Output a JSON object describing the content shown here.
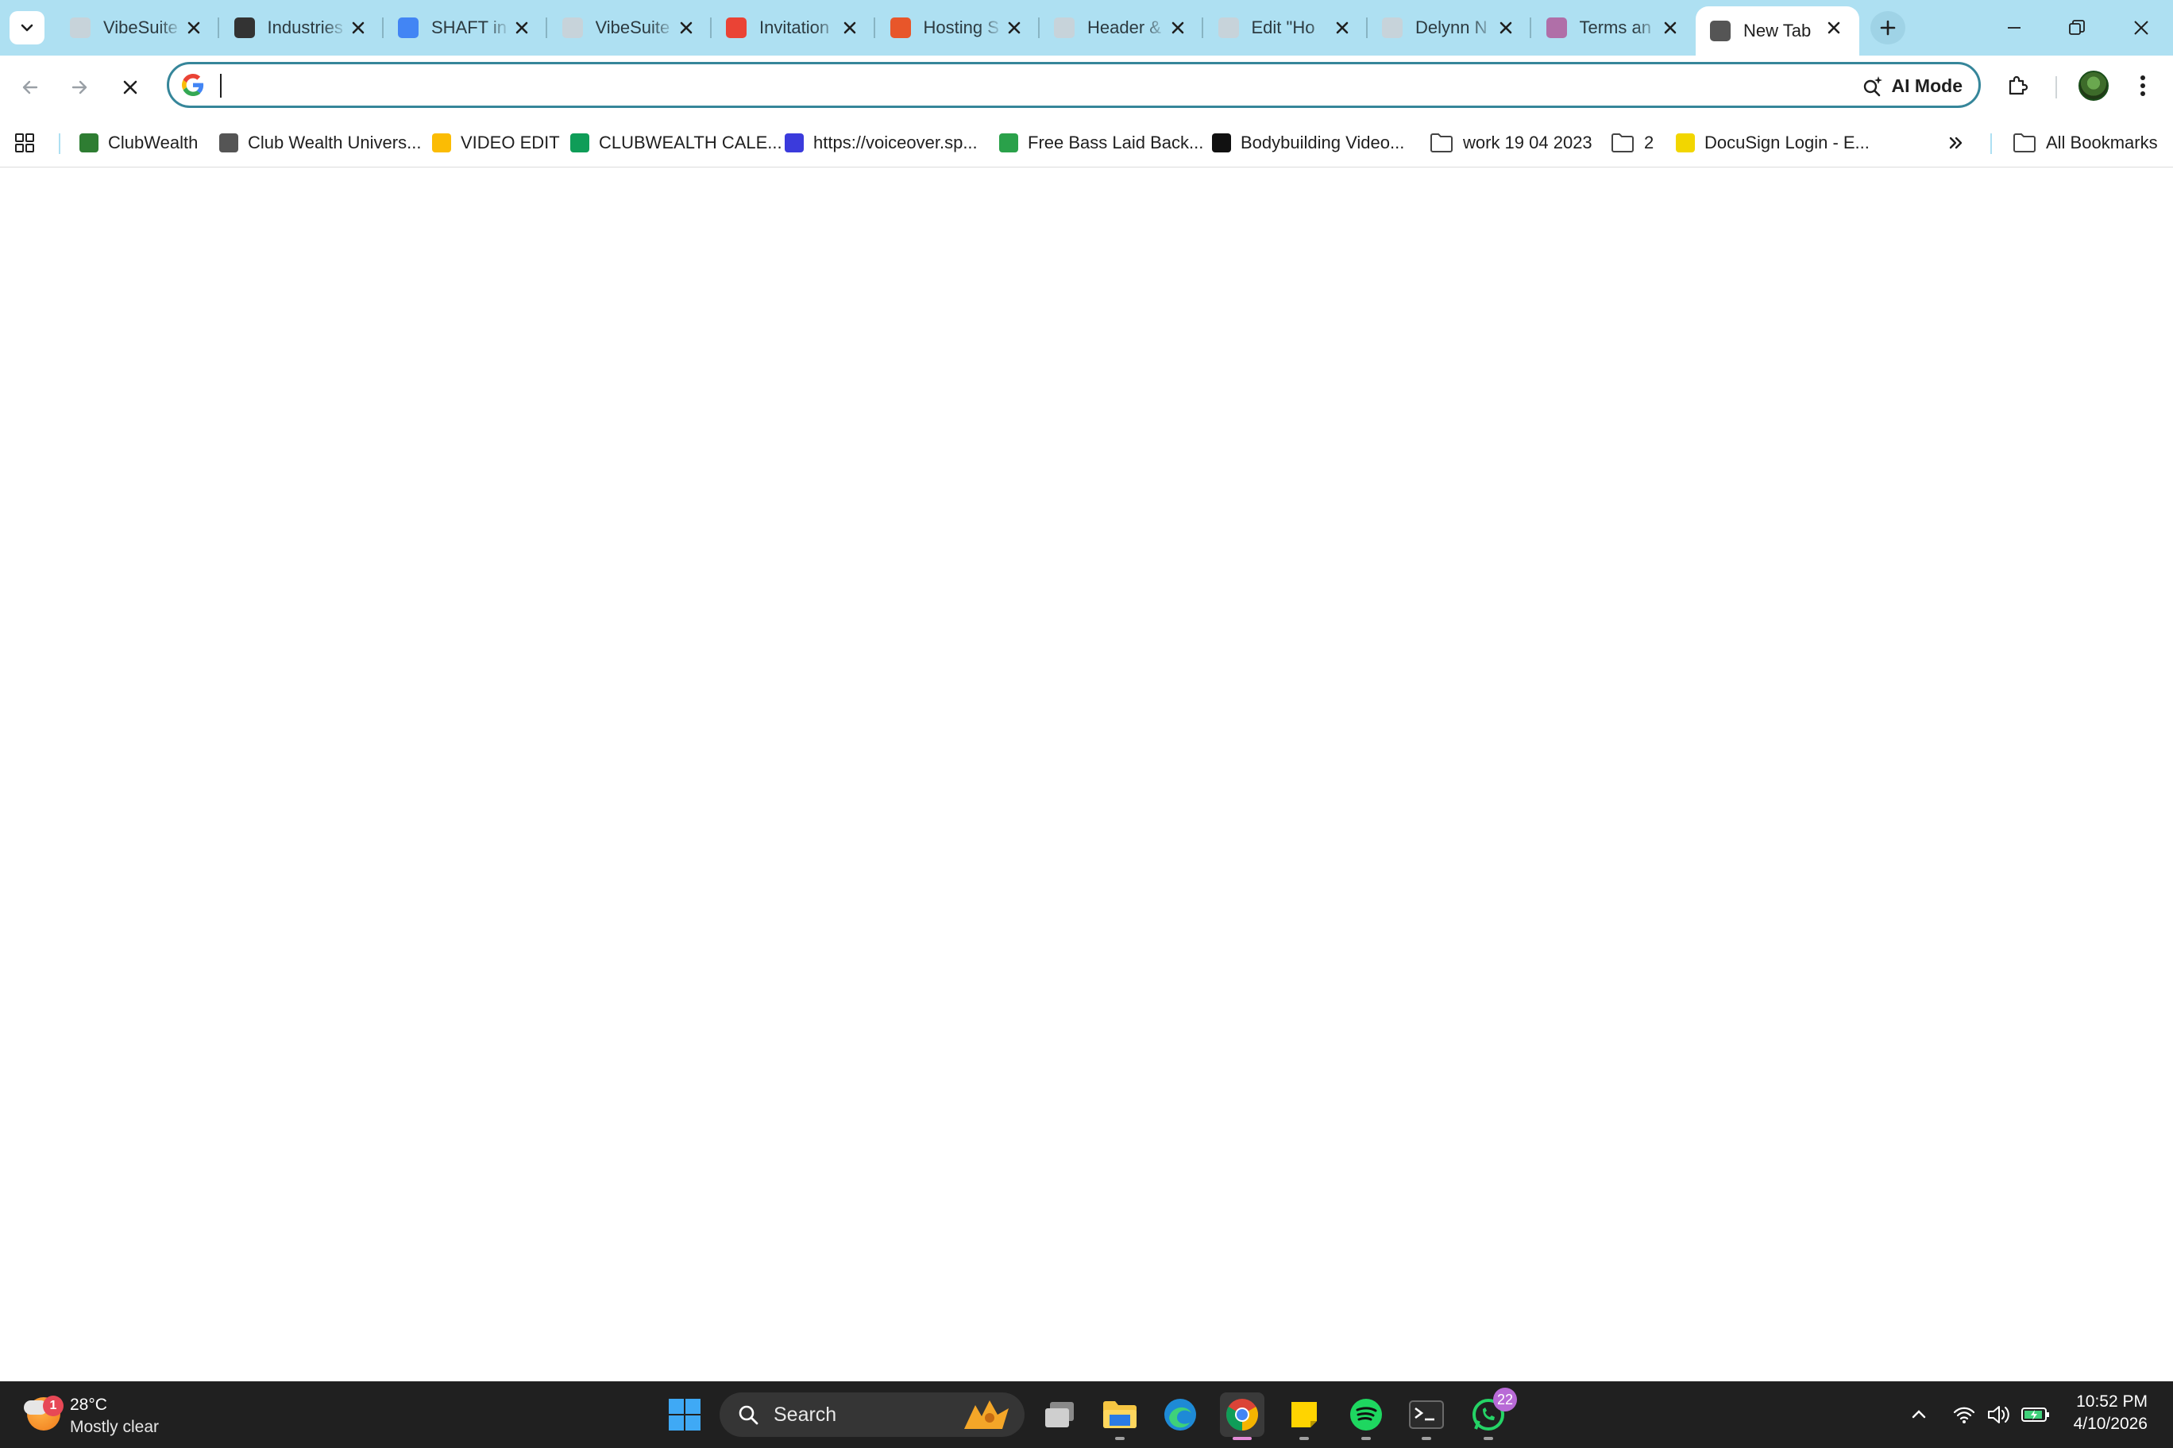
{
  "browser": {
    "tabs": [
      {
        "title": "VibeSuite",
        "favicon": "vibesuite-favicon",
        "color": "#c7d3da"
      },
      {
        "title": "Industries",
        "favicon": "openai-favicon",
        "color": "#333333"
      },
      {
        "title": "SHAFT in",
        "favicon": "google-favicon",
        "color": "#4285f4"
      },
      {
        "title": "VibeSuite",
        "favicon": "vibesuite-favicon",
        "color": "#c7d3da"
      },
      {
        "title": "Invitation",
        "favicon": "gmail-favicon",
        "color": "#ea4335"
      },
      {
        "title": "Hosting S",
        "favicon": "hosting-favicon",
        "color": "#e8562a"
      },
      {
        "title": "Header &",
        "favicon": "vibesuite-favicon",
        "color": "#c7d3da"
      },
      {
        "title": "Edit \"Ho",
        "favicon": "vibesuite-favicon",
        "color": "#c7d3da"
      },
      {
        "title": "Delynn N",
        "favicon": "vibesuite-favicon",
        "color": "#c7d3da"
      },
      {
        "title": "Terms an",
        "favicon": "terms-favicon",
        "color": "#b06fa8"
      },
      {
        "title": "New Tab",
        "favicon": "chrome-newtab-favicon",
        "color": "#555555"
      }
    ],
    "active_tab_index": 10
  },
  "toolbar": {
    "omnibox_value": "",
    "ai_mode_label": "AI Mode",
    "accent": "#36869a"
  },
  "bookmarks": [
    {
      "label": "ClubWealth",
      "icon": "clubwealth-icon",
      "color": "#2e7d32"
    },
    {
      "label": "Club Wealth Univers...",
      "icon": "star-icon",
      "color": "#555555"
    },
    {
      "label": "VIDEO EDIT",
      "icon": "google-drive-icon",
      "color": "#fbbc04"
    },
    {
      "label": "CLUBWEALTH CALE...",
      "icon": "google-sheets-icon",
      "color": "#0f9d58"
    },
    {
      "label": "https://voiceover.sp...",
      "icon": "voiceover-icon",
      "color": "#3b3bdc"
    },
    {
      "label": "Free Bass Laid Back...",
      "icon": "px-icon",
      "color": "#2aa14a"
    },
    {
      "label": "Bodybuilding Video...",
      "icon": "p-icon",
      "color": "#111111"
    },
    {
      "label": "work 19 04 2023",
      "icon": "folder-icon",
      "color": "#444444"
    },
    {
      "label": "2",
      "icon": "folder-icon",
      "color": "#444444"
    },
    {
      "label": "DocuSign Login - E...",
      "icon": "docusign-icon",
      "color": "#f2d600"
    }
  ],
  "all_bookmarks_label": "All Bookmarks",
  "taskbar": {
    "weather": {
      "temp": "28°C",
      "condition": "Mostly clear",
      "badge": "1"
    },
    "search_label": "Search",
    "whatsapp_badge": "22",
    "time": "10:52 PM",
    "date": "4/10/2026"
  }
}
